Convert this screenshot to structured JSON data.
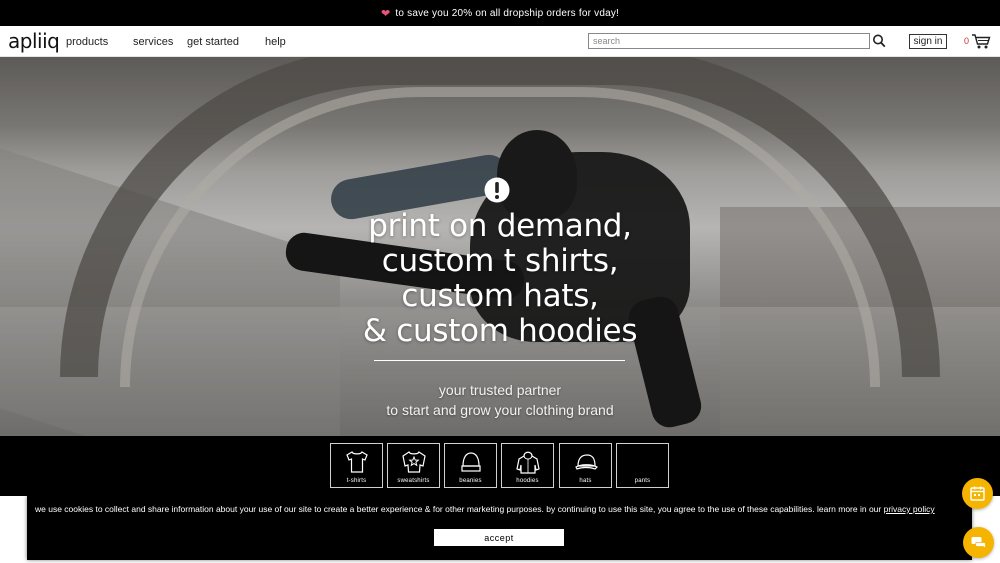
{
  "promo": {
    "text": "to save you 20% on all dropship orders for vday!"
  },
  "header": {
    "logo": "apliiq",
    "nav": [
      {
        "label": "products"
      },
      {
        "label": "services"
      },
      {
        "label": "get started"
      },
      {
        "label": "help"
      }
    ],
    "search_placeholder": "search",
    "signin_label": "sign in",
    "cart_count": "0"
  },
  "hero": {
    "headline": [
      "print on demand,",
      "custom t shirts,",
      "custom hats,",
      "& custom hoodies"
    ],
    "tagline": [
      "your trusted partner",
      "to start and grow your clothing brand"
    ]
  },
  "categories": [
    {
      "label": "t-shirts",
      "icon": "tshirt-icon"
    },
    {
      "label": "sweatshirts",
      "icon": "sweatshirt-icon"
    },
    {
      "label": "beanies",
      "icon": "beanie-icon"
    },
    {
      "label": "hoodies",
      "icon": "hoodie-icon"
    },
    {
      "label": "hats",
      "icon": "hat-icon"
    },
    {
      "label": "pants",
      "icon": "pants-icon"
    }
  ],
  "cookie": {
    "text": "we use cookies to collect and share information about your use of our site to create a better experience & for other marketing purposes. by continuing to use this site, you agree to the use of these capabilities. learn more in our",
    "link": "privacy policy",
    "accept_label": "accept"
  },
  "colors": {
    "promo_bg": "#000000",
    "heart": "#e8547a",
    "widget": "#f4b400",
    "cart_count": "#cc3333"
  }
}
